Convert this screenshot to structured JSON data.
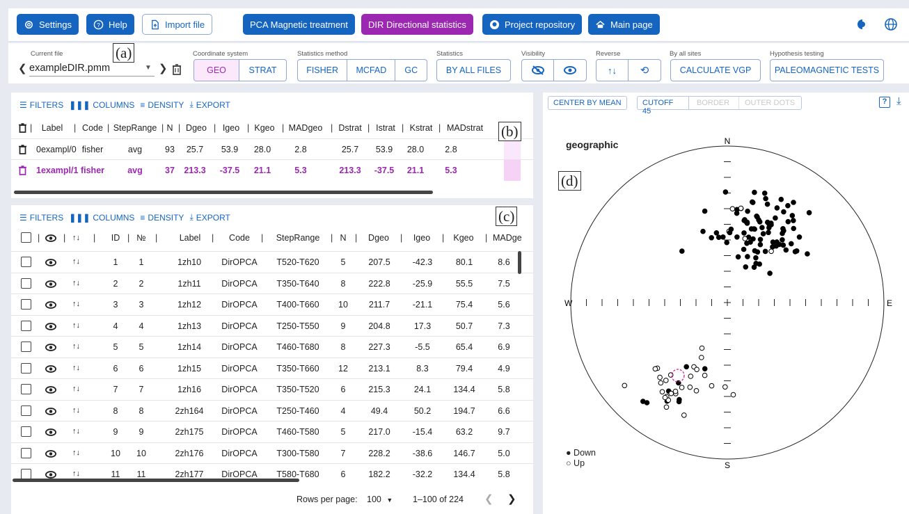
{
  "nav": {
    "settings": "Settings",
    "help": "Help",
    "import": "Import file",
    "pca": "PCA  Magnetic treatment",
    "dir": "DIR  Directional statistics",
    "repo": "Project repository",
    "main": "Main page"
  },
  "toolbar": {
    "current_file_label": "Current file",
    "current_file": "exampleDIR.pmm",
    "coord_label": "Coordinate system",
    "coord_options": [
      "GEO",
      "STRAT"
    ],
    "stat_method_label": "Statistics method",
    "stat_methods": [
      "FISHER",
      "MCFAD",
      "GC"
    ],
    "statistics_label": "Statistics",
    "statistics_btn": "BY ALL FILES",
    "visibility_label": "Visibility",
    "reverse_label": "Reverse",
    "by_sites_label": "By all sites",
    "vgp_btn": "CALCULATE VGP",
    "hyp_label": "Hypothesis testing",
    "hyp_btn": "PALEOMAGNETIC TESTS"
  },
  "grid_toolbar": {
    "filters": "FILTERS",
    "columns": "COLUMNS",
    "density": "DENSITY",
    "export": "EXPORT"
  },
  "stats_table": {
    "headers": [
      "Label",
      "Code",
      "StepRange",
      "N",
      "Dgeo",
      "Igeo",
      "Kgeo",
      "MADgeo",
      "Dstrat",
      "Istrat",
      "Kstrat",
      "MADstrat"
    ],
    "rows": [
      [
        "0exampl/0",
        "fisher",
        "avg",
        "93",
        "25.7",
        "53.9",
        "28.0",
        "2.8",
        "25.7",
        "53.9",
        "28.0",
        "2.8"
      ],
      [
        "1exampl/1",
        "fisher",
        "avg",
        "37",
        "213.3",
        "-37.5",
        "21.1",
        "5.3",
        "213.3",
        "-37.5",
        "21.1",
        "5.3"
      ]
    ]
  },
  "data_table": {
    "headers": [
      "ID",
      "№",
      "Label",
      "Code",
      "StepRange",
      "N",
      "Dgeo",
      "Igeo",
      "Kgeo",
      "MADge"
    ],
    "rows": [
      [
        "1",
        "1",
        "1zh10",
        "DirOPCA",
        "T520-T620",
        "5",
        "207.5",
        "-42.3",
        "80.1",
        "8.6"
      ],
      [
        "2",
        "2",
        "1zh11",
        "DirOPCA",
        "T350-T640",
        "8",
        "222.8",
        "-25.9",
        "55.5",
        "7.5"
      ],
      [
        "3",
        "3",
        "1zh12",
        "DirOPCA",
        "T400-T660",
        "10",
        "211.7",
        "-21.1",
        "75.4",
        "5.6"
      ],
      [
        "4",
        "4",
        "1zh13",
        "DirOPCA",
        "T250-T550",
        "9",
        "204.8",
        "17.3",
        "50.7",
        "7.3"
      ],
      [
        "5",
        "5",
        "1zh14",
        "DirOPCA",
        "T460-T680",
        "8",
        "227.3",
        "-5.5",
        "65.4",
        "6.9"
      ],
      [
        "6",
        "6",
        "1zh15",
        "DirOPCA",
        "T350-T660",
        "12",
        "213.1",
        "8.3",
        "79.4",
        "4.9"
      ],
      [
        "7",
        "7",
        "1zh16",
        "DirOPCA",
        "T350-T520",
        "6",
        "215.3",
        "24.1",
        "134.4",
        "5.8"
      ],
      [
        "8",
        "8",
        "2zh164",
        "DirOPCA",
        "T250-T460",
        "4",
        "49.4",
        "50.2",
        "194.7",
        "6.6"
      ],
      [
        "9",
        "9",
        "2zh175",
        "DirOPCA",
        "T460-T580",
        "5",
        "217.0",
        "-15.4",
        "63.2",
        "9.7"
      ],
      [
        "10",
        "10",
        "2zh176",
        "DirOPCA",
        "T300-T580",
        "7",
        "228.2",
        "-38.6",
        "146.7",
        "5.0"
      ],
      [
        "11",
        "11",
        "2zh177",
        "DirOPCA",
        "T580-T680",
        "6",
        "182.2",
        "-32.2",
        "134.4",
        "5.8"
      ]
    ],
    "rows_per_page_label": "Rows per page:",
    "rows_per_page": "100",
    "range": "1–100 of 224"
  },
  "plot": {
    "center_by_mean": "CENTER BY MEAN",
    "cutoff": "CUTOFF 45",
    "border": "BORDER",
    "outer_dots": "OUTER DOTS",
    "title": "geographic",
    "n": "N",
    "s": "S",
    "w": "W",
    "e": "E",
    "legend_down": "Down",
    "legend_up": "Up"
  },
  "labels": {
    "a": "(a)",
    "b": "(b)",
    "c": "(c)",
    "d": "(d)"
  },
  "colors": {
    "primary": "#1565c0",
    "purple": "#9c27b0"
  }
}
